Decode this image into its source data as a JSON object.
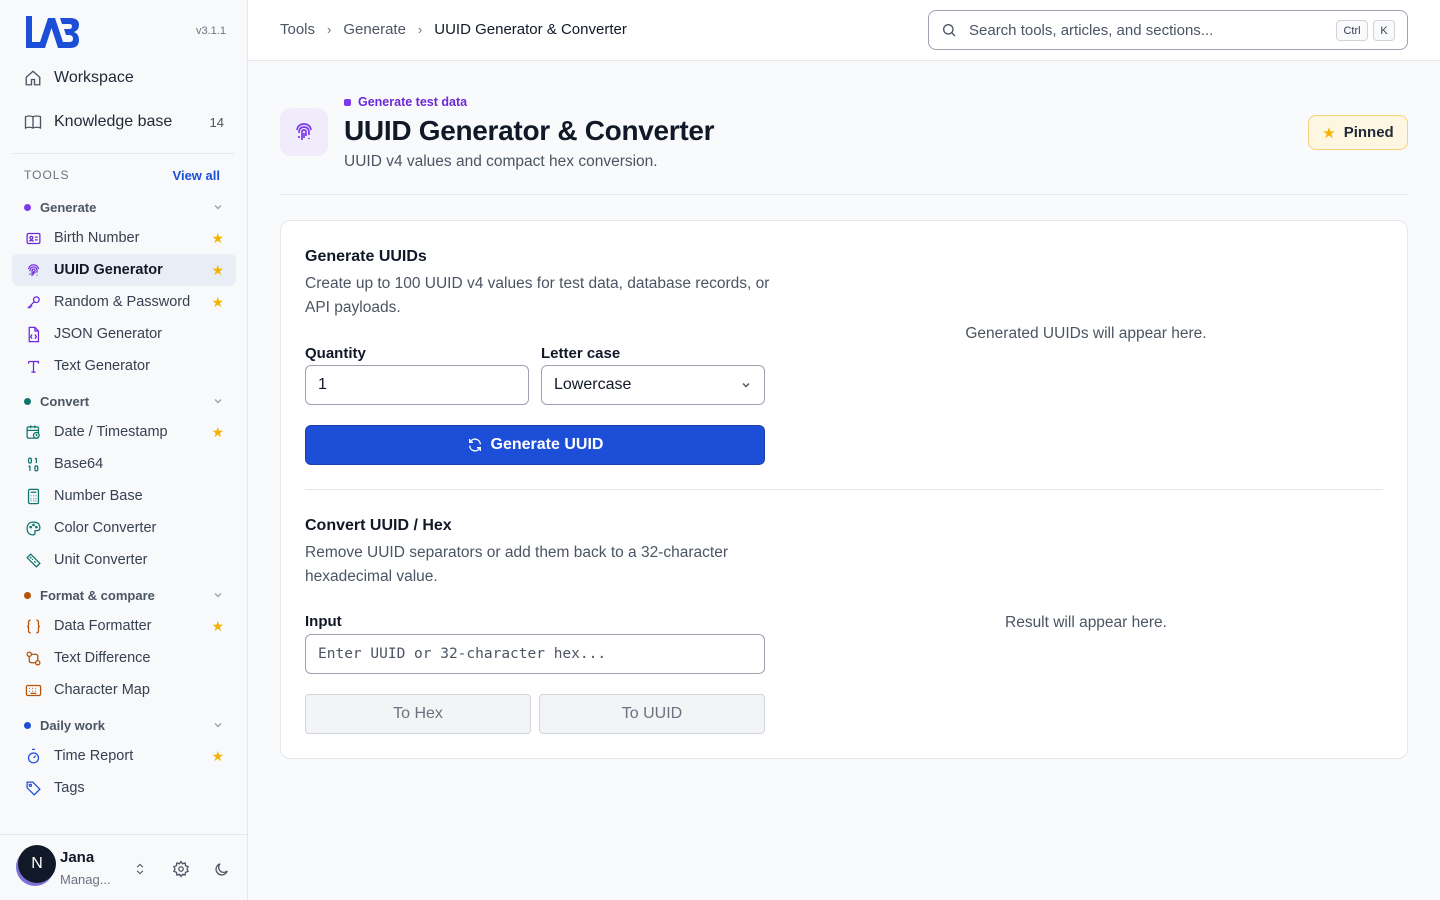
{
  "app": {
    "version": "v3.1.1",
    "logo_text": "LAB"
  },
  "nav": {
    "items": [
      {
        "label": "Workspace",
        "icon": "home-icon"
      },
      {
        "label": "Knowledge base",
        "icon": "book-icon",
        "count": "14"
      }
    ]
  },
  "tools": {
    "label": "TOOLS",
    "view_all": "View all",
    "groups": [
      {
        "name": "Generate",
        "color": "#7c3aed",
        "items": [
          {
            "label": "Birth Number",
            "icon": "id-card-icon",
            "starred": true
          },
          {
            "label": "UUID Generator",
            "icon": "fingerprint-icon",
            "starred": true,
            "active": true
          },
          {
            "label": "Random & Password",
            "icon": "key-icon",
            "starred": true
          },
          {
            "label": "JSON Generator",
            "icon": "file-code-icon"
          },
          {
            "label": "Text Generator",
            "icon": "type-icon"
          }
        ]
      },
      {
        "name": "Convert",
        "color": "#0f766e",
        "items": [
          {
            "label": "Date / Timestamp",
            "icon": "calendar-clock-icon",
            "starred": true
          },
          {
            "label": "Base64",
            "icon": "binary-icon"
          },
          {
            "label": "Number Base",
            "icon": "calculator-icon"
          },
          {
            "label": "Color Converter",
            "icon": "palette-icon"
          },
          {
            "label": "Unit Converter",
            "icon": "ruler-icon"
          }
        ]
      },
      {
        "name": "Format & compare",
        "color": "#b45309",
        "items": [
          {
            "label": "Data Formatter",
            "icon": "braces-icon",
            "starred": true
          },
          {
            "label": "Text Difference",
            "icon": "diff-icon"
          },
          {
            "label": "Character Map",
            "icon": "keyboard-icon"
          }
        ]
      },
      {
        "name": "Daily work",
        "color": "#1d4ed8",
        "items": [
          {
            "label": "Time Report",
            "icon": "timer-icon",
            "starred": true
          },
          {
            "label": "Tags",
            "icon": "tag-icon"
          }
        ]
      }
    ]
  },
  "user": {
    "initial": "N",
    "name": "Jana",
    "role": "Manag..."
  },
  "breadcrumb": [
    "Tools",
    "Generate",
    "UUID Generator & Converter"
  ],
  "search": {
    "placeholder": "Search tools, articles, and sections...",
    "kbd_ctrl": "Ctrl",
    "kbd_key": "K"
  },
  "header": {
    "eyebrow": "Generate test data",
    "title": "UUID Generator & Converter",
    "subtitle": "UUID v4 values and compact hex conversion.",
    "pinned_label": "Pinned"
  },
  "generate": {
    "title": "Generate UUIDs",
    "description": "Create up to 100 UUID v4 values for test data, database records, or API payloads.",
    "quantity_label": "Quantity",
    "quantity_value": "1",
    "case_label": "Letter case",
    "case_value": "Lowercase",
    "button_label": "Generate UUID",
    "empty_text": "Generated UUIDs will appear here."
  },
  "convert": {
    "title": "Convert UUID / Hex",
    "description": "Remove UUID separators or add them back to a 32-character hexadecimal value.",
    "input_label": "Input",
    "input_placeholder": "Enter UUID or 32-character hex...",
    "to_hex_label": "To Hex",
    "to_uuid_label": "To UUID",
    "empty_text": "Result will appear here."
  },
  "colors": {
    "accent": "#1d4ed8",
    "brand": "#1d4ed8",
    "star": "#f5b301",
    "generate_purple": "#7c3aed"
  }
}
